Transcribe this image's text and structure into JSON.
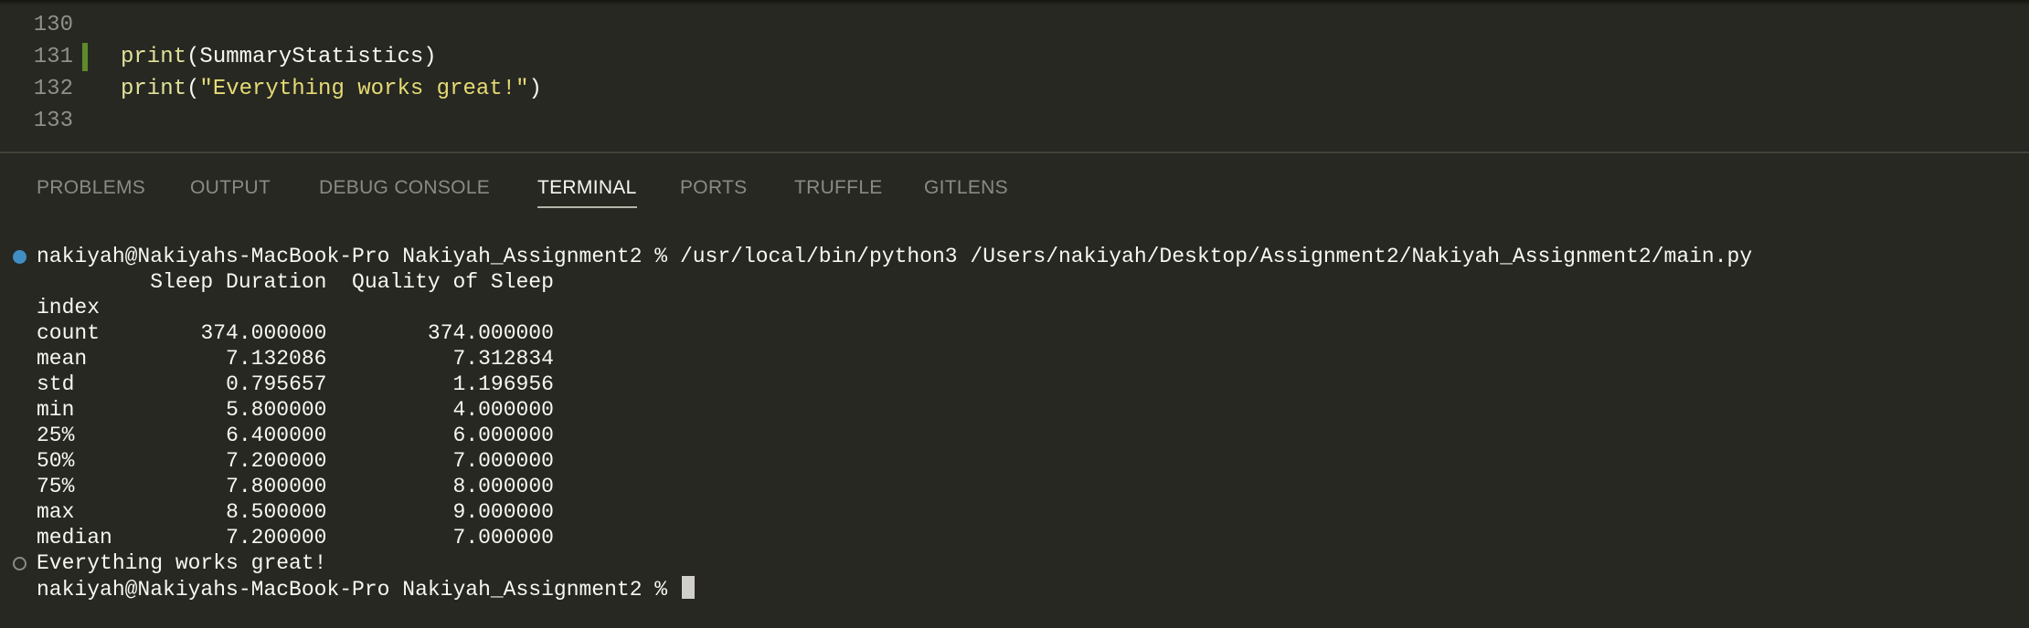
{
  "editor": {
    "lines": [
      {
        "number": "130",
        "parts": []
      },
      {
        "number": "131",
        "modified": true,
        "parts": [
          {
            "cls": "tok-fn builtin",
            "text": "print"
          },
          {
            "cls": "tok-paren",
            "text": "("
          },
          {
            "cls": "tok-ident",
            "text": "SummaryStatistics"
          },
          {
            "cls": "tok-paren",
            "text": ")"
          }
        ]
      },
      {
        "number": "132",
        "parts": [
          {
            "cls": "tok-fn builtin",
            "text": "print"
          },
          {
            "cls": "tok-paren",
            "text": "("
          },
          {
            "cls": "tok-str",
            "text": "\"Everything works great!\""
          },
          {
            "cls": "tok-paren",
            "text": ")"
          }
        ]
      },
      {
        "number": "133",
        "parts": []
      }
    ]
  },
  "panel": {
    "tabs": [
      "PROBLEMS",
      "OUTPUT",
      "DEBUG CONSOLE",
      "TERMINAL",
      "PORTS",
      "TRUFFLE",
      "GITLENS"
    ],
    "active_tab": "TERMINAL"
  },
  "terminal": {
    "prompt": "nakiyah@Nakiyahs-MacBook-Pro Nakiyah_Assignment2 %",
    "command": "/usr/local/bin/python3 /Users/nakiyah/Desktop/Assignment2/Nakiyah_Assignment2/main.py",
    "table_header": "         Sleep Duration  Quality of Sleep",
    "index_label": "index",
    "rows": [
      {
        "label": "count",
        "sleep_duration": "374.000000",
        "quality_of_sleep": "374.000000"
      },
      {
        "label": "mean",
        "sleep_duration": "7.132086",
        "quality_of_sleep": "7.312834"
      },
      {
        "label": "std",
        "sleep_duration": "0.795657",
        "quality_of_sleep": "1.196956"
      },
      {
        "label": "min",
        "sleep_duration": "5.800000",
        "quality_of_sleep": "4.000000"
      },
      {
        "label": "25%",
        "sleep_duration": "6.400000",
        "quality_of_sleep": "6.000000"
      },
      {
        "label": "50%",
        "sleep_duration": "7.200000",
        "quality_of_sleep": "7.000000"
      },
      {
        "label": "75%",
        "sleep_duration": "7.800000",
        "quality_of_sleep": "8.000000"
      },
      {
        "label": "max",
        "sleep_duration": "8.500000",
        "quality_of_sleep": "9.000000"
      },
      {
        "label": "median",
        "sleep_duration": "7.200000",
        "quality_of_sleep": "7.000000"
      }
    ],
    "output_message": "Everything works great!"
  },
  "colors": {
    "background": "#272822",
    "success_decoration": "#3f8fc5",
    "modified_gutter": "#5f8a2c"
  }
}
